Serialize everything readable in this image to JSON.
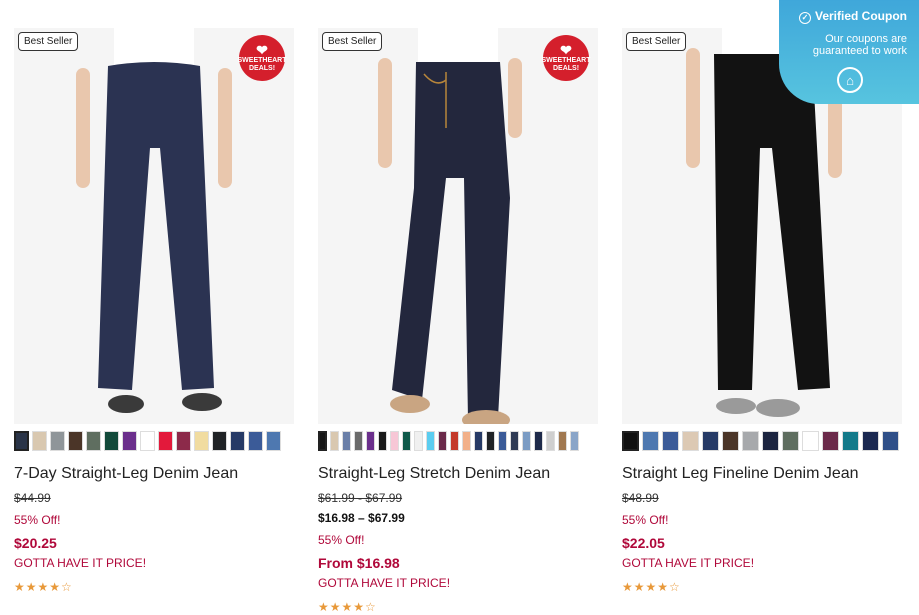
{
  "coupon": {
    "title": "Verified Coupon",
    "subtitle_line1": "Our coupons are",
    "subtitle_line2": "guaranteed to work"
  },
  "products": [
    {
      "badge": "Best Seller",
      "deal_badge": "SWEETHEART DEALS!",
      "pant_color": "#2b3352",
      "swatches": [
        "#2a3448",
        "#d9c8b0",
        "#8f9599",
        "#4b3528",
        "#5f6e60",
        "#124a3a",
        "#6b2f8c",
        "#ffffff",
        "#e3193b",
        "#8c2a4a",
        "#f1dca0",
        "#202326",
        "#263a66",
        "#3b5b98",
        "#4e78b0"
      ],
      "title": "7-Day Straight-Leg Denim Jean",
      "original_price": "$44.99",
      "discount": "55% Off!",
      "price": "$20.25",
      "promo": "GOTTA HAVE IT PRICE!",
      "rating": 4,
      "stars": "★★★★☆"
    },
    {
      "badge": "Best Seller",
      "deal_badge": "SWEETHEART DEALS!",
      "pant_color": "#23273d",
      "swatches": [
        "#151515",
        "#d9c8b0",
        "#6a7fa8",
        "#6a6a6a",
        "#6b2f8c",
        "#1a1a1a",
        "#f7c7d6",
        "#0f5a4a",
        "#f0f0f0",
        "#5bcdf0",
        "#6b2a4a",
        "#c43a2a",
        "#f2b089",
        "#263a66",
        "#202326",
        "#3b5b98",
        "#2f3b55",
        "#7b9cc4",
        "#1e2a4a",
        "#cfcfcf",
        "#a07850",
        "#8aa5c8"
      ],
      "title": "Straight-Leg Stretch Denim Jean",
      "original_price": "$61.99 - $67.99",
      "price_range": "$16.98 – $67.99",
      "discount": "55% Off!",
      "price": "From $16.98",
      "promo": "GOTTA HAVE IT PRICE!",
      "rating": 4,
      "stars": "★★★★☆"
    },
    {
      "badge": "Best Seller",
      "pant_color": "#121212",
      "swatches": [
        "#111111",
        "#4e78b0",
        "#3b5b98",
        "#dcc9b4",
        "#263a66",
        "#4b3528",
        "#a7a9ac",
        "#1c2540",
        "#5f6e60",
        "#ffffff",
        "#6b2a4a",
        "#137a8a",
        "#1a2850",
        "#2f4f88"
      ],
      "title": "Straight Leg Fineline Denim Jean",
      "original_price": "$48.99",
      "discount": "55% Off!",
      "price": "$22.05",
      "promo": "GOTTA HAVE IT PRICE!",
      "rating": 4,
      "stars": "★★★★☆"
    }
  ]
}
